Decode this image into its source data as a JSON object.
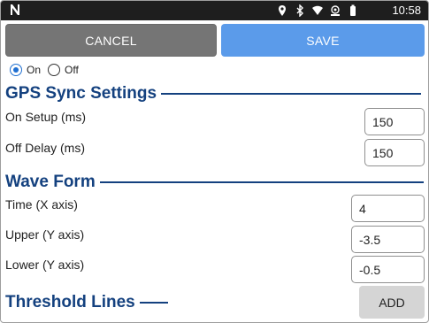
{
  "status_bar": {
    "time": "10:58",
    "icons": [
      "location-icon",
      "bluetooth-icon",
      "wifi-icon",
      "hotspot-icon",
      "battery-icon"
    ]
  },
  "actions": {
    "cancel_label": "CANCEL",
    "save_label": "SAVE"
  },
  "toggle": {
    "on_label": "On",
    "off_label": "Off",
    "selected": "On"
  },
  "gps_sync": {
    "title": "GPS Sync Settings",
    "on_setup_label": "On Setup (ms)",
    "on_setup_value": "150",
    "off_delay_label": "Off Delay (ms)",
    "off_delay_value": "150"
  },
  "wave_form": {
    "title": "Wave Form",
    "time_label": "Time (X axis)",
    "time_value": "4",
    "upper_label": "Upper (Y axis)",
    "upper_value": "-3.5",
    "lower_label": "Lower (Y axis)",
    "lower_value": "-0.5"
  },
  "threshold": {
    "title": "Threshold Lines",
    "add_label": "ADD"
  },
  "colors": {
    "accent": "#14417f",
    "save": "#5b9bea",
    "cancel": "#757575",
    "radio": "#1f6fd1"
  }
}
